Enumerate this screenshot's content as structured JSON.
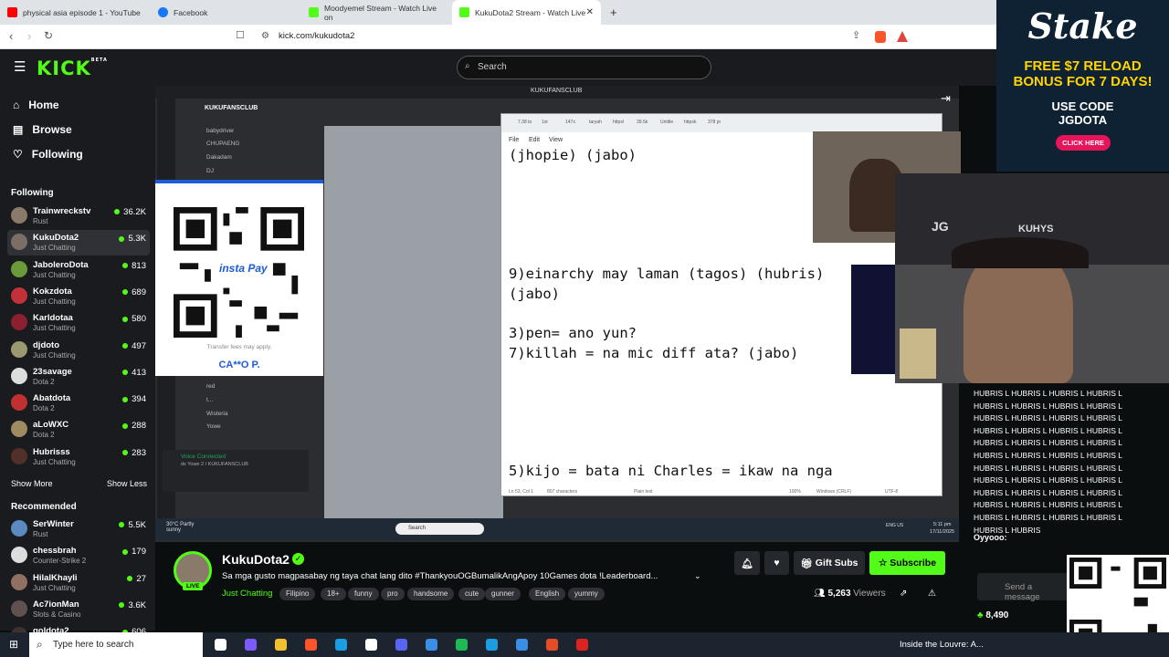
{
  "browser": {
    "tabs": [
      {
        "title": "physical asia episode 1 - YouTube",
        "color": "#ff0000"
      },
      {
        "title": "Facebook",
        "color": "#1877f2"
      },
      {
        "title": "Moodyemel Stream - Watch Live on",
        "color": "#53fc18"
      },
      {
        "title": "KukuDota2 Stream - Watch Live",
        "color": "#53fc18"
      }
    ],
    "new_tab": "+",
    "url": "kick.com/kukudota2"
  },
  "kick": {
    "logo": "KICK",
    "logo_beta": "BETA",
    "search_placeholder": "Search",
    "nav": [
      {
        "label": "Home",
        "icon": "home-icon"
      },
      {
        "label": "Browse",
        "icon": "browse-icon"
      },
      {
        "label": "Following",
        "icon": "heart-icon"
      }
    ],
    "following_header": "Following",
    "following": [
      {
        "name": "Trainwreckstv",
        "category": "Rust",
        "viewers": "36.2K",
        "color": "#8a7a6a"
      },
      {
        "name": "KukuDota2",
        "category": "Just Chatting",
        "viewers": "5.3K",
        "color": "#7a6e66"
      },
      {
        "name": "JaboleroDota",
        "category": "Just Chatting",
        "viewers": "813",
        "color": "#6a9a3a"
      },
      {
        "name": "Kokzdota",
        "category": "Just Chatting",
        "viewers": "689",
        "color": "#c2303a"
      },
      {
        "name": "Karldotaa",
        "category": "Just Chatting",
        "viewers": "580",
        "color": "#8a2030"
      },
      {
        "name": "djdoto",
        "category": "Just Chatting",
        "viewers": "497",
        "color": "#9a9a70"
      },
      {
        "name": "23savage",
        "category": "Dota 2",
        "viewers": "413",
        "color": "#ddd"
      },
      {
        "name": "Abatdota",
        "category": "Dota 2",
        "viewers": "394",
        "color": "#c03030"
      },
      {
        "name": "aLoWXC",
        "category": "Dota 2",
        "viewers": "288",
        "color": "#a08a60"
      },
      {
        "name": "Hubrisss",
        "category": "Just Chatting",
        "viewers": "283",
        "color": "#503028"
      }
    ],
    "show_more": "Show More",
    "show_less": "Show Less",
    "recommended_header": "Recommended",
    "recommended": [
      {
        "name": "SerWinter",
        "category": "Rust",
        "viewers": "5.5K",
        "color": "#5a8ac0"
      },
      {
        "name": "chessbrah",
        "category": "Counter-Strike 2",
        "viewers": "179",
        "color": "#ddd"
      },
      {
        "name": "HilalKhayli",
        "category": "Just Chatting",
        "viewers": "27",
        "color": "#907060"
      },
      {
        "name": "Ac7ionMan",
        "category": "Slots & Casino",
        "viewers": "3.6K",
        "color": "#605050"
      },
      {
        "name": "goldota2",
        "category": "",
        "viewers": "606",
        "color": "#403030"
      }
    ]
  },
  "stream_overlay": {
    "window_title": "KUKUFANSCLUB",
    "discord_server": "KUKUFANSCLUB",
    "discord_members": [
      "babydriver",
      "CHUPAENG",
      "Dakadam",
      "DJ",
      "red",
      "t...",
      "Wisteria",
      "Yowe"
    ],
    "voice_connected": "Voice Connected",
    "voice_channel": "ds Yowe 2 / KUKUFANSCLUB",
    "qr_note": "Transfer fees may apply.",
    "qr_name": "CA**O P.",
    "qr_brand": "insta Pay",
    "editor_tabs": [
      "7.38 to",
      "1st",
      "147x",
      "taryah",
      "httpsl",
      "39.5k",
      "Untitle",
      "httpsk",
      "378 pr"
    ],
    "editor_menu": [
      "File",
      "Edit",
      "View"
    ],
    "editor_lines": [
      "(jhopie) (jabo)",
      "9)einarchy may laman (tagos) (hubris)",
      "(jabo)",
      "3)pen= ano yun?",
      "7)killah = na mic diff ata? (jabo)",
      "5)kijo = bata ni Charles = ikaw na nga"
    ],
    "editor_status": [
      "Ln 53, Col 1",
      "807 characters",
      "Plain text",
      "100%",
      "Windows (CRLF)",
      "UTF-8"
    ],
    "weather": "30°C Partly sunny",
    "win_search": "Search",
    "win_time": "5:11 pm",
    "win_date": "17/11/2025",
    "win_lang": "ENG US",
    "cam_letters": "JG",
    "cam_brand": "KUHYS"
  },
  "ad": {
    "brand": "Stake",
    "headline": "FREE $7 RELOAD BONUS FOR 7 DAYS!",
    "code_label": "USE CODE",
    "code": "JGDOTA",
    "cta": "CLICK HERE"
  },
  "chat": {
    "spam_lines": [
      "HUBRIS L HUBRIS L HUBRIS L HUBRIS L",
      "HUBRIS L HUBRIS L HUBRIS L HUBRIS L",
      "HUBRIS L HUBRIS L HUBRIS L HUBRIS L",
      "HUBRIS L HUBRIS L HUBRIS L HUBRIS L",
      "HUBRIS L HUBRIS L HUBRIS L HUBRIS L",
      "HUBRIS L HUBRIS L HUBRIS L HUBRIS L",
      "HUBRIS L HUBRIS L HUBRIS L HUBRIS L",
      "HUBRIS L HUBRIS L HUBRIS L HUBRIS L",
      "HUBRIS L HUBRIS L HUBRIS L HUBRIS L",
      "HUBRIS L HUBRIS L HUBRIS L HUBRIS L",
      "HUBRIS L HUBRIS L HUBRIS L HUBRIS L",
      "HUBRIS L HUBRIS"
    ],
    "last_user": "Oyyooo:",
    "send_placeholder": "Send a message",
    "points": "8,490"
  },
  "channel": {
    "name": "KukuDota2",
    "live_badge": "LIVE",
    "title": "Sa mga gusto magpasabay ng taya chat lang dito #ThankyouOGBumalikAngApoy 10Games dota  !Leaderboard...",
    "category": "Just Chatting",
    "tags": [
      "Filipino",
      "18+",
      "funny",
      "pro",
      "handsome",
      "cute",
      "gunner",
      "English",
      "yummy"
    ],
    "gift_subs": "Gift Subs",
    "subscribe": "Subscribe",
    "viewers": "5,263",
    "viewers_label": "Viewers",
    "accent": "#53fc18"
  },
  "taskbar": {
    "search_placeholder": "Type here to search",
    "now_playing": "Inside the Louvre: A..."
  }
}
